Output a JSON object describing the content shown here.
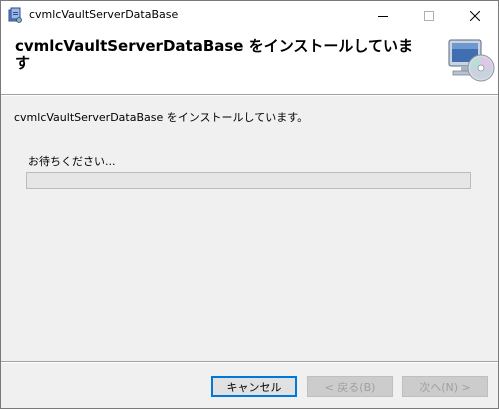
{
  "window": {
    "title": "cvmlcVaultServerDataBase"
  },
  "banner": {
    "title": "cvmlcVaultServerDataBase をインストールしています"
  },
  "content": {
    "status_text": "cvmlcVaultServerDataBase をインストールしています。",
    "wait_text": "お待ちください...",
    "progress": 0
  },
  "buttons": {
    "cancel": "キャンセル",
    "back": "< 戻る(B)",
    "next": "次へ(N) >"
  },
  "icons": {
    "app": "installer-package-icon",
    "banner": "computer-cd-icon",
    "minimize": "minimize-icon",
    "maximize": "maximize-icon",
    "close": "close-icon"
  },
  "colors": {
    "accent": "#0078d7",
    "disabled_text": "#a0a0a0"
  }
}
